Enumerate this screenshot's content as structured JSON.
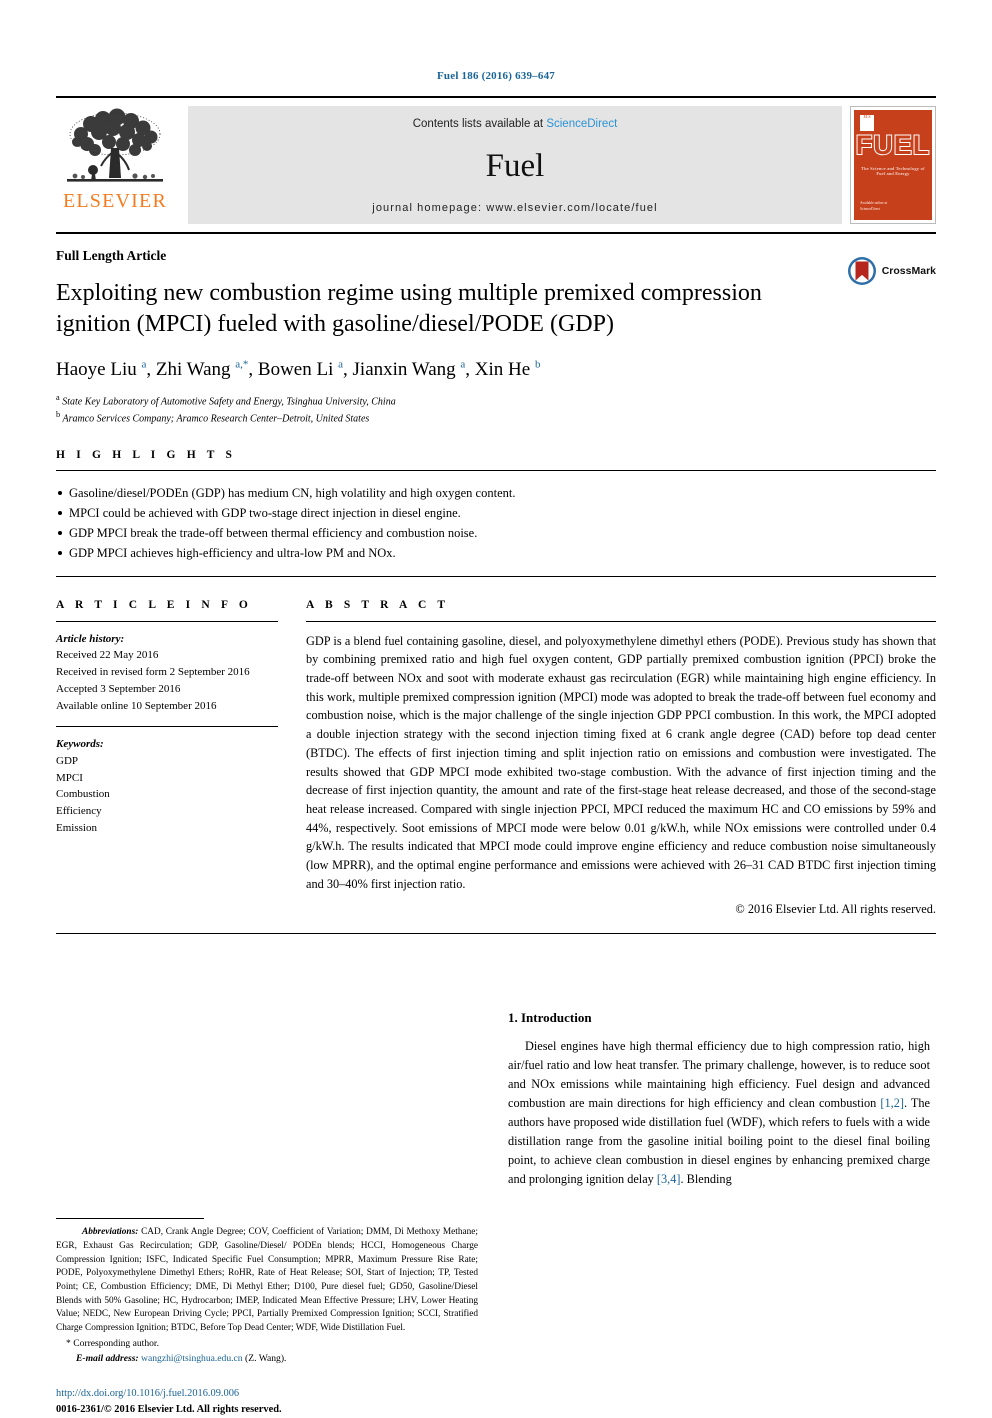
{
  "running_head": "Fuel 186 (2016) 639–647",
  "masthead": {
    "contents_prefix": "Contents lists available at ",
    "sciencedirect": "ScienceDirect",
    "journal_name": "Fuel",
    "homepage": "journal homepage: www.elsevier.com/locate/fuel",
    "publisher_word": "ELSEVIER",
    "cover": {
      "title": "FUEL",
      "subtitle": "The Science and Technology of Fuel and Energy",
      "footer": "Available online at\nScienceDirect"
    }
  },
  "article": {
    "type": "Full Length Article",
    "title": "Exploiting new combustion regime using multiple premixed compression ignition (MPCI) fueled with gasoline/diesel/PODE (GDP)",
    "crossmark_label": "CrossMark",
    "authors_html": "Haoye Liu <sup>a</sup>, Zhi Wang <sup>a,*</sup>, Bowen Li <sup>a</sup>, Jianxin Wang <sup>a</sup>, Xin He <sup>b</sup>",
    "affiliations": [
      "State Key Laboratory of Automotive Safety and Energy, Tsinghua University, China",
      "Aramco Services Company; Aramco Research Center–Detroit, United States"
    ],
    "affiliation_marks": [
      "a",
      "b"
    ]
  },
  "highlights": {
    "label": "H I G H L I G H T S",
    "items": [
      "Gasoline/diesel/PODEn (GDP) has medium CN, high volatility and high oxygen content.",
      "MPCI could be achieved with GDP two-stage direct injection in diesel engine.",
      "GDP MPCI break the trade-off between thermal efficiency and combustion noise.",
      "GDP MPCI achieves high-efficiency and ultra-low PM and NOx."
    ]
  },
  "article_info": {
    "label": "A R T I C L E   I N F O",
    "history_label": "Article history:",
    "history": [
      "Received 22 May 2016",
      "Received in revised form 2 September 2016",
      "Accepted 3 September 2016",
      "Available online 10 September 2016"
    ],
    "keywords_label": "Keywords:",
    "keywords": [
      "GDP",
      "MPCI",
      "Combustion",
      "Efficiency",
      "Emission"
    ]
  },
  "abstract": {
    "label": "A B S T R A C T",
    "text": "GDP is a blend fuel containing gasoline, diesel, and polyoxymethylene dimethyl ethers (PODE). Previous study has shown that by combining premixed ratio and high fuel oxygen content, GDP partially premixed combustion ignition (PPCI) broke the trade-off between NOx and soot with moderate exhaust gas recirculation (EGR) while maintaining high engine efficiency. In this work, multiple premixed compression ignition (MPCI) mode was adopted to break the trade-off between fuel economy and combustion noise, which is the major challenge of the single injection GDP PPCI combustion. In this work, the MPCI adopted a double injection strategy with the second injection timing fixed at 6 crank angle degree (CAD) before top dead center (BTDC). The effects of first injection timing and split injection ratio on emissions and combustion were investigated. The results showed that GDP MPCI mode exhibited two-stage combustion. With the advance of first injection timing and the decrease of first injection quantity, the amount and rate of the first-stage heat release decreased, and those of the second-stage heat release increased. Compared with single injection PPCI, MPCI reduced the maximum HC and CO emissions by 59% and 44%, respectively. Soot emissions of MPCI mode were below 0.01 g/kW.h, while NOx emissions were controlled under 0.4 g/kW.h. The results indicated that MPCI mode could improve engine efficiency and reduce combustion noise simultaneously (low MPRR), and the optimal engine performance and emissions were achieved with 26–31 CAD BTDC first injection timing and 30–40% first injection ratio.",
    "copyright": "© 2016 Elsevier Ltd. All rights reserved."
  },
  "footnotes": {
    "abbreviations_label": "Abbreviations:",
    "abbreviations": "CAD, Crank Angle Degree; COV, Coefficient of Variation; DMM, Di Methoxy Methane; EGR, Exhaust Gas Recirculation; GDP, Gasoline/Diesel/ PODEn blends; HCCI, Homogeneous Charge Compression Ignition; ISFC, Indicated Specific Fuel Consumption; MPRR, Maximum Pressure Rise Rate; PODE, Polyoxymethylene Dimethyl Ethers; RoHR, Rate of Heat Release; SOI, Start of Injection; TP, Tested Point; CE, Combustion Efficiency; DME, Di Methyl Ether; D100, Pure diesel fuel; GD50, Gasoline/Diesel Blends with 50% Gasoline; HC, Hydrocarbon; IMEP, Indicated Mean Effective Pressure; LHV, Lower Heating Value; NEDC, New European Driving Cycle; PPCI, Partially Premixed Compression Ignition; SCCI, Stratified Charge Compression Ignition; BTDC, Before Top Dead Center; WDF, Wide Distillation Fuel.",
    "corresponding": "* Corresponding author.",
    "email_label": "E-mail address:",
    "email": "wangzhi@tsinghua.edu.cn",
    "email_suffix": "(Z. Wang).",
    "doi": "http://dx.doi.org/10.1016/j.fuel.2016.09.006",
    "issn": "0016-2361/© 2016 Elsevier Ltd. All rights reserved."
  },
  "introduction": {
    "heading": "1. Introduction",
    "paragraph_parts": {
      "p1_a": "Diesel engines have high thermal efficiency due to high compression ratio, high air/fuel ratio and low heat transfer. The primary challenge, however, is to reduce soot and NOx emissions while maintaining high efficiency. Fuel design and advanced combustion are main directions for high efficiency and clean combustion ",
      "cite1": "[1,2]",
      "p1_b": ". The authors have proposed wide distillation fuel (WDF), which refers to fuels with a wide distillation range from the gasoline initial boiling point to the diesel final boiling point, to achieve clean combustion in diesel engines by enhancing premixed charge and prolonging ignition delay ",
      "cite2": "[3,4]",
      "p1_c": ". Blending"
    }
  },
  "colors": {
    "link": "#1a6496",
    "sciencedirect": "#2a93d5",
    "elsevier_orange": "#f47c20",
    "cover_red": "#c7401c",
    "masthead_gray": "#e4e4e4"
  }
}
